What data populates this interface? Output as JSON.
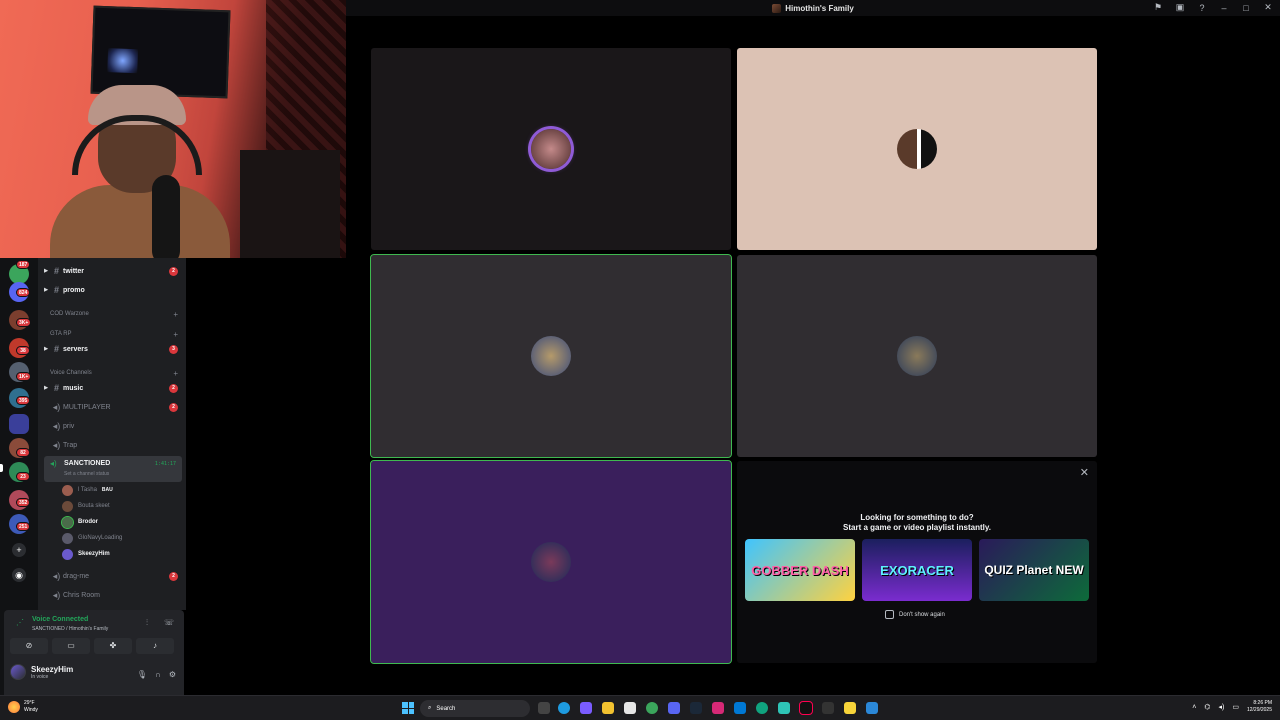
{
  "window": {
    "title": "Himothin's Family"
  },
  "rail": {
    "badges": [
      "187",
      "824",
      "3K+",
      "38",
      "1K+",
      "395",
      "82",
      "23",
      "352",
      "251"
    ]
  },
  "channels": {
    "text": [
      {
        "name": "twitter",
        "badge": "2"
      },
      {
        "name": "promo",
        "badge": ""
      }
    ],
    "categories": {
      "cod": "COD Warzone",
      "gta": "GTA RP",
      "voice": "Voice Channels"
    },
    "servers": {
      "name": "servers",
      "badge": "3"
    },
    "voice": [
      {
        "name": "music",
        "badge": "2"
      },
      {
        "name": "MULTIPLAYER",
        "badge": "2"
      },
      {
        "name": "priv",
        "badge": ""
      },
      {
        "name": "Trap",
        "badge": ""
      }
    ],
    "active": {
      "name": "SANCTIONED",
      "timer": "1:41:17",
      "status": "Set a channel status"
    },
    "voice_users": [
      {
        "name": "l Tasha",
        "tag": "BAU"
      },
      {
        "name": "Bouta skeet"
      },
      {
        "name": "Brodor"
      },
      {
        "name": "GloNavyLoading"
      },
      {
        "name": "SkeezyHim"
      }
    ],
    "after": [
      {
        "name": "drag-me",
        "badge": "2"
      },
      {
        "name": "Chris Room",
        "badge": ""
      }
    ]
  },
  "voice_panel": {
    "status": "Voice Connected",
    "location": "SANCTIONED / Himothin's Family",
    "user": {
      "name": "SkeezyHim",
      "status": "In voice"
    }
  },
  "activity": {
    "heading_1": "Looking for something to do?",
    "heading_2": "Start a game or video playlist instantly.",
    "games": [
      "GOBBER DASH",
      "EXORACER",
      "QUIZ Planet NEW"
    ],
    "dont_show": "Don't show again"
  },
  "taskbar": {
    "weather_temp": "29°F",
    "weather_desc": "Windy",
    "search": "Search",
    "time": "8:26 PM",
    "date": "12/29/2025"
  },
  "colors": {
    "speaking": "#3fb950",
    "voice_green": "#23a55a",
    "badge_red": "#da373c",
    "tile_purple": "#3a1f5c",
    "tile_peach": "#dcc2b4"
  }
}
